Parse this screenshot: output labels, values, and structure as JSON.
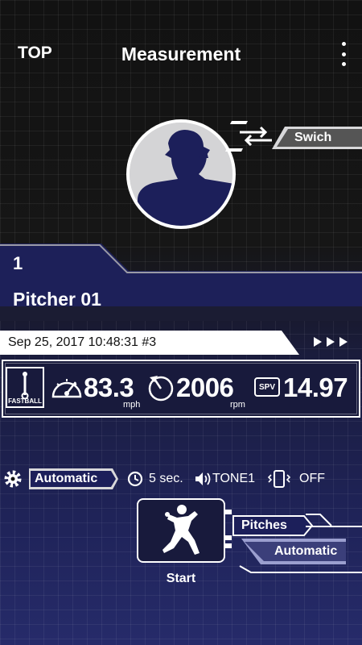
{
  "header": {
    "top_label": "TOP",
    "title": "Measurement",
    "menu_icon": "more-vert-icon"
  },
  "switch": {
    "label": "Swich",
    "icon": "swap-arrows-icon"
  },
  "pitcher": {
    "number": "1",
    "name": "Pitcher 01"
  },
  "record": {
    "datetime": "Sep 25, 2017 10:48:31 #3"
  },
  "stats": {
    "pitch_type": "FASTBALL",
    "speed": "83.3",
    "speed_unit": "mph",
    "rotation": "2006",
    "rotation_unit": "rpm",
    "spv_label": "SPV",
    "spv": "14.97"
  },
  "settings": {
    "mode": "Automatic",
    "interval": "5 sec.",
    "tone": "TONE1",
    "vibration": "OFF"
  },
  "actions": {
    "start_label": "Start",
    "pitches_label": "Pitches",
    "automatic_label": "Automatic"
  },
  "colors": {
    "navy": "#1c1f5a",
    "panel": "#181a3c",
    "light_gray": "#d4d4d6"
  }
}
